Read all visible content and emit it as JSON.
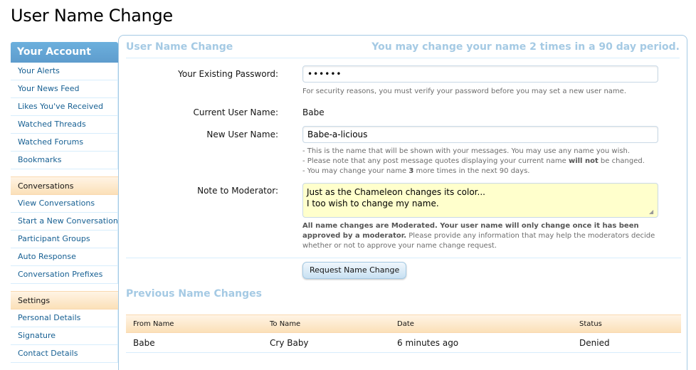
{
  "page": {
    "title": "User Name Change"
  },
  "sidebar": {
    "header": "Your Account",
    "account_items": [
      "Your Alerts",
      "Your News Feed",
      "Likes You've Received",
      "Watched Threads",
      "Watched Forums",
      "Bookmarks"
    ],
    "conversations_header": "Conversations",
    "conversation_items": [
      "View Conversations",
      "Start a New Conversation",
      "Participant Groups",
      "Auto Response",
      "Conversation Prefixes"
    ],
    "settings_header": "Settings",
    "settings_items": [
      "Personal Details",
      "Signature",
      "Contact Details"
    ]
  },
  "form": {
    "heading": "User Name Change",
    "limit_notice": "You may change your name 2 times in a 90 day period.",
    "password_label": "Your Existing Password:",
    "password_value": "••••••",
    "password_hint": "For security reasons, you must verify your password before you may set a new user name.",
    "current_label": "Current User Name:",
    "current_value": "Babe",
    "new_label": "New User Name:",
    "new_value": "Babe-a-licious",
    "new_hint_1": "- This is the name that will be shown with your messages. You may use any name you wish.",
    "new_hint_2_pre": "- Please note that any post message quotes displaying your current name ",
    "new_hint_2_bold": "will not",
    "new_hint_2_post": " be changed.",
    "new_hint_3_pre": "- You may change your name ",
    "new_hint_3_bold": "3",
    "new_hint_3_post": " more times in the next 90 days.",
    "note_label": "Note to Moderator:",
    "note_line_1": "Just as the Chameleon changes its color...",
    "note_line_2": "I too wish to change my name.",
    "note_hint_bold": "All name changes are Moderated. Your user name will only change once it has been approved by a moderator.",
    "note_hint_rest": " Please provide any information that may help the moderators decide whether or not to approve your name change request.",
    "submit_label": "Request Name Change"
  },
  "history": {
    "heading": "Previous Name Changes",
    "columns": [
      "From Name",
      "To Name",
      "Date",
      "Status"
    ],
    "rows": [
      [
        "Babe",
        "Cry Baby",
        "6 minutes ago",
        "Denied"
      ]
    ]
  },
  "colors": {
    "accent": "#a5cae4",
    "sidebar_header": "#65a5d1",
    "link": "#176093",
    "section_bg": "#fbe0b8",
    "note_bg": "#ffffcc"
  }
}
